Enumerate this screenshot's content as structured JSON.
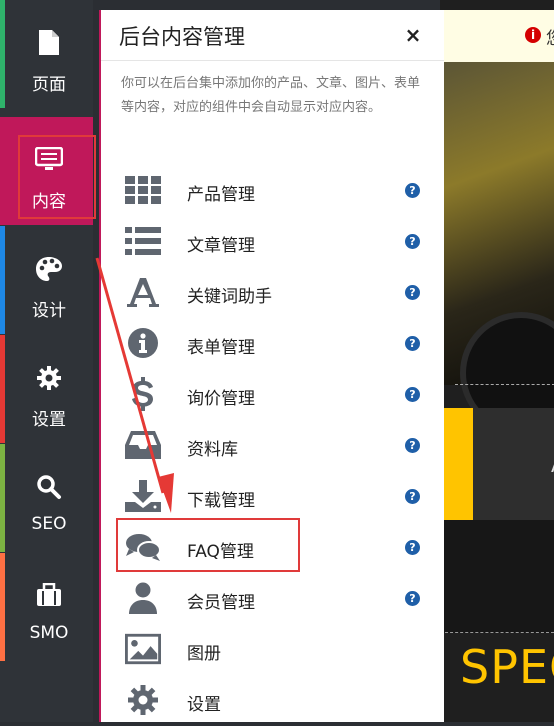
{
  "sidebar": {
    "items": [
      {
        "label": "页面",
        "icon": "file-icon",
        "accent": "#2fb36b"
      },
      {
        "label": "内容",
        "icon": "monitor-icon",
        "accent": "#c0185a",
        "active": true
      },
      {
        "label": "设计",
        "icon": "palette-icon",
        "accent": "#1e88e5"
      },
      {
        "label": "设置",
        "icon": "gear-icon",
        "accent": "#e53935"
      },
      {
        "label": "SEO",
        "icon": "search-icon",
        "accent": "#7cb342"
      },
      {
        "label": "SMO",
        "icon": "briefcase-icon",
        "accent": "#ff7043"
      }
    ]
  },
  "panel": {
    "title": "后台内容管理",
    "close": "×",
    "description": "你可以在后台集中添加你的产品、文章、图片、表单等内容，对应的组件中会自动显示对应内容。",
    "help_glyph": "?",
    "items": [
      {
        "label": "产品管理",
        "icon": "grid-icon",
        "help": true
      },
      {
        "label": "文章管理",
        "icon": "list-icon",
        "help": true
      },
      {
        "label": "关键词助手",
        "icon": "font-icon",
        "help": true
      },
      {
        "label": "表单管理",
        "icon": "info-icon",
        "help": true
      },
      {
        "label": "询价管理",
        "icon": "dollar-icon",
        "help": true
      },
      {
        "label": "资料库",
        "icon": "inbox-icon",
        "help": true
      },
      {
        "label": "下载管理",
        "icon": "download-icon",
        "help": true
      },
      {
        "label": "FAQ管理",
        "icon": "comments-icon",
        "help": true,
        "highlighted": true
      },
      {
        "label": "会员管理",
        "icon": "user-icon",
        "help": true
      },
      {
        "label": "图册",
        "icon": "image-icon",
        "help": false
      },
      {
        "label": "设置",
        "icon": "gear-icon",
        "help": false
      }
    ]
  },
  "background": {
    "notice_glyph": "i",
    "notice_text": "您",
    "band_letter": "A",
    "banner_text": "SPEC"
  },
  "colors": {
    "active": "#c0185a",
    "annotation": "#e03a3a",
    "help": "#1f5fa8",
    "icon_gray": "#5f6670",
    "yellow": "#ffc400"
  }
}
